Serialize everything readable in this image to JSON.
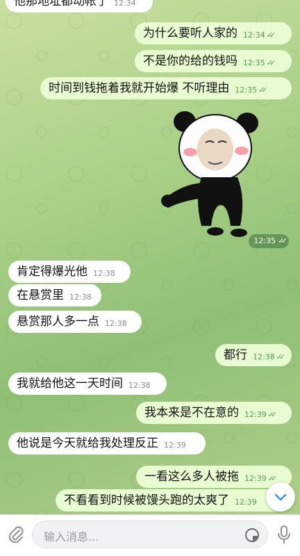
{
  "messages": [
    {
      "text": "他那地址都动帐了",
      "time": "12:34",
      "dir": "in"
    },
    {
      "text": "为什么要听人家的",
      "time": "12:34",
      "dir": "out"
    },
    {
      "text": "不是你的给的钱吗",
      "time": "12:35",
      "dir": "out"
    },
    {
      "text": "时间到钱拖着我就开始爆 不听理由",
      "time": "12:35",
      "dir": "out"
    },
    {
      "text": "肯定得爆光他",
      "time": "12:38",
      "dir": "in"
    },
    {
      "text": "在悬赏里",
      "time": "12:38",
      "dir": "in"
    },
    {
      "text": "悬赏那人多一点",
      "time": "12:38",
      "dir": "in"
    },
    {
      "text": "都行",
      "time": "12:38",
      "dir": "out"
    },
    {
      "text": "我就给他这一天时间",
      "time": "12:38",
      "dir": "in"
    },
    {
      "text": "我本来是不在意的",
      "time": "12:39",
      "dir": "out"
    },
    {
      "text": "他说是今天就给我处理反正",
      "time": "12:39",
      "dir": "in"
    },
    {
      "text": "一看这么多人被拖",
      "time": "12:39",
      "dir": "out"
    },
    {
      "text": "不看看到时候被馒头跑的太爽了",
      "time": "12:39",
      "dir": "out"
    }
  ],
  "sticker": {
    "time": "12:35",
    "icon": "panda-meme-sticker"
  },
  "read_ticks": "✓✓",
  "input": {
    "placeholder": "输入消息..."
  },
  "icons": {
    "attach": "paperclip-icon",
    "emoji": "sticker-emoji-icon",
    "mic": "microphone-icon",
    "scroll_down": "chevron-down-icon"
  },
  "colors": {
    "incoming_bubble": "#ffffff",
    "outgoing_bubble": "#e9fbd0",
    "check_green": "#4fa14c",
    "accent_blue": "#3a8ee6"
  }
}
